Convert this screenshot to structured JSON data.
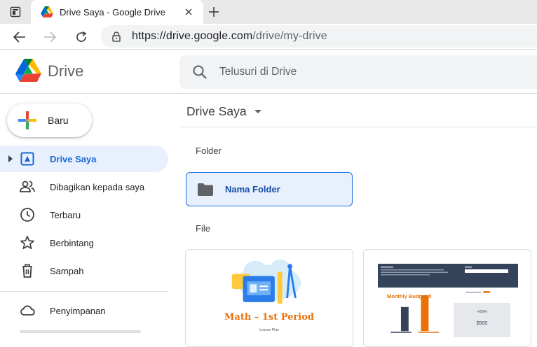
{
  "browser": {
    "tab_title": "Drive Saya - Google Drive",
    "url_host": "https://drive.google.com",
    "url_path": "/drive/my-drive"
  },
  "app": {
    "name": "Drive",
    "search_placeholder": "Telusuri di Drive"
  },
  "sidebar": {
    "new_label": "Baru",
    "items": [
      {
        "label": "Drive Saya",
        "icon": "my-drive-icon",
        "active": true
      },
      {
        "label": "Dibagikan kepada saya",
        "icon": "shared-people-icon"
      },
      {
        "label": "Terbaru",
        "icon": "clock-icon"
      },
      {
        "label": "Berbintang",
        "icon": "star-icon"
      },
      {
        "label": "Sampah",
        "icon": "trash-icon"
      }
    ],
    "storage_label": "Penyimpanan"
  },
  "main": {
    "breadcrumb": "Drive Saya",
    "folder_section": "Folder",
    "folders": [
      {
        "name": "Nama Folder"
      }
    ],
    "file_section": "File",
    "files": [
      {
        "thumb_title": "Math – 1st Period",
        "thumb_subtitle": "Lesson Plan"
      },
      {
        "thumb_title": "Monthly Budget X",
        "thumb_box_value": "$500",
        "thumb_box_pct": "+50%"
      }
    ]
  },
  "colors": {
    "accent": "#1a73e8",
    "active_bg": "#e8f0fe",
    "active_text": "#1967d2"
  }
}
